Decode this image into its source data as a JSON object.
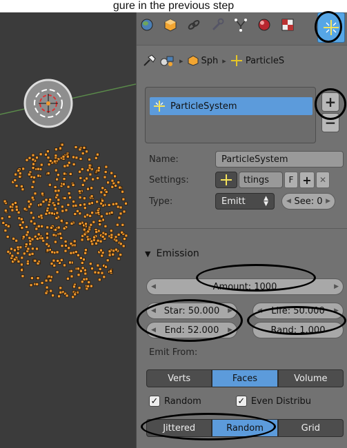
{
  "heading": "gure in the previous step",
  "context_tabs": [
    {
      "icon": "world-icon"
    },
    {
      "icon": "object-icon"
    },
    {
      "icon": "constraints-icon"
    },
    {
      "icon": "modifier-wrench-icon"
    },
    {
      "icon": "object-data-icon"
    },
    {
      "icon": "material-icon"
    },
    {
      "icon": "texture-icon"
    },
    {
      "icon": "particles-icon",
      "active": true
    }
  ],
  "breadcrumb": {
    "object": "Sph",
    "particles": "ParticleS"
  },
  "particle_list": {
    "items": [
      "ParticleSystem"
    ],
    "selected": "ParticleSystem",
    "add_symbol": "+",
    "remove_symbol": "−"
  },
  "name_row": {
    "label": "Name:",
    "value": "ParticleSystem"
  },
  "settings_row": {
    "label": "Settings:",
    "value": "ttings",
    "fake_user": "F",
    "new_symbol": "+",
    "unlink_symbol": "✕"
  },
  "type_row": {
    "label": "Type:",
    "type_value": "Emitt",
    "seed_value": "See: 0"
  },
  "emission": {
    "title": "Emission",
    "amount": "Amount: 1000",
    "start": "Star: 50.000",
    "end": "End: 52.000",
    "lifetime": "Life: 50.000",
    "random": "Rand: 1.000",
    "emit_from_label": "Emit From:",
    "emit_from_options": [
      "Verts",
      "Faces",
      "Volume"
    ],
    "emit_from_selected": "Faces",
    "random_check": {
      "label": "Random",
      "checked": true
    },
    "even_check": {
      "label": "Even Distribu",
      "checked": true
    },
    "distribution_options": [
      "Jittered",
      "Random",
      "Grid"
    ],
    "distribution_selected": "Random"
  },
  "colors": {
    "accent": "#5c9bdb",
    "particles": "#f29a2e",
    "viewport": "#3b3b3b",
    "annotation": "#000000"
  }
}
